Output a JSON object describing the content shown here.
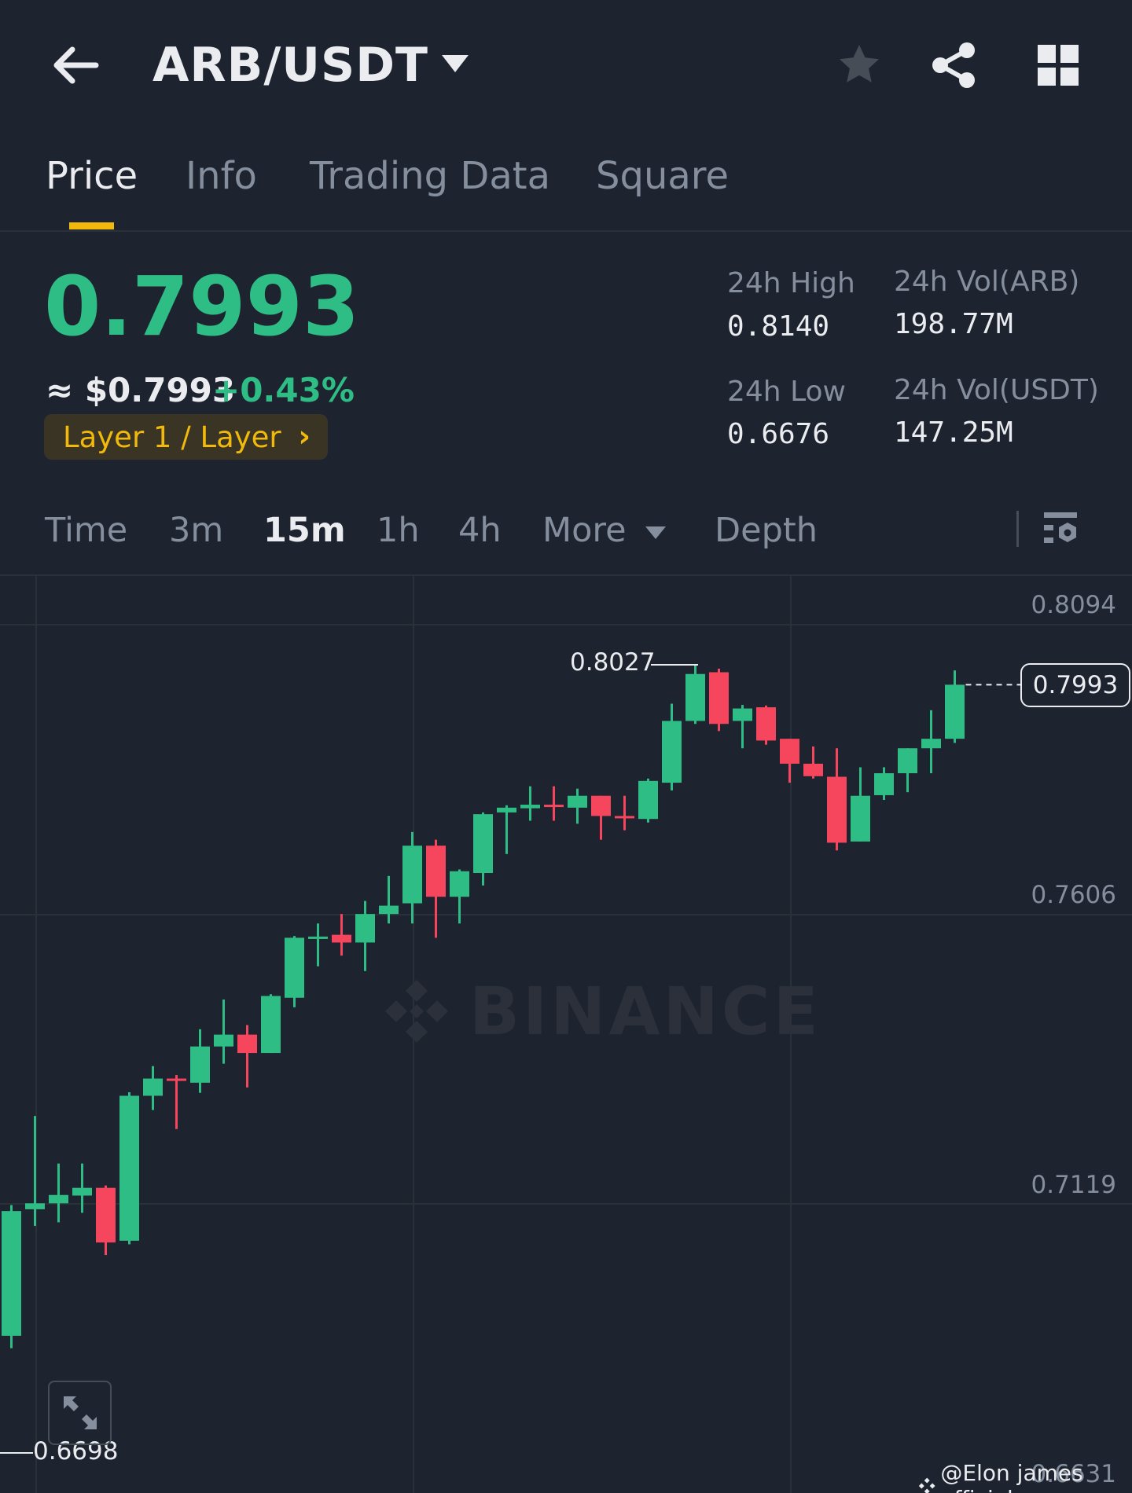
{
  "header": {
    "title": "ARB/USDT",
    "back_icon": "arrow-left-icon",
    "dropdown_icon": "caret-down-icon",
    "favorite_icon": "star-icon",
    "share_icon": "share-icon",
    "grid_icon": "grid-icon"
  },
  "tabs": [
    {
      "label": "Price",
      "active": true
    },
    {
      "label": "Info"
    },
    {
      "label": "Trading Data"
    },
    {
      "label": "Square"
    }
  ],
  "ticker": {
    "price": "0.7993",
    "fiat_price": "≈ $0.7993",
    "change_pct": "+0.43%",
    "category_tag": "Layer 1 / Layer",
    "high_label": "24h High",
    "high_value": "0.8140",
    "low_label": "24h Low",
    "low_value": "0.6676",
    "vol_base_label": "24h Vol(ARB)",
    "vol_base_value": "198.77M",
    "vol_quote_label": "24h Vol(USDT)",
    "vol_quote_value": "147.25M"
  },
  "intervals": [
    {
      "label": "Time"
    },
    {
      "label": "3m"
    },
    {
      "label": "15m",
      "active": true
    },
    {
      "label": "1h"
    },
    {
      "label": "4h"
    },
    {
      "label": "More"
    },
    {
      "label": "Depth"
    }
  ],
  "colors": {
    "up": "#2ebd85",
    "down": "#f6465d",
    "accent": "#f0b90b",
    "background": "#1e2330"
  },
  "watermark": "BINANCE",
  "credit": "@Elon james official",
  "chart_data": {
    "type": "candlestick",
    "interval": "15m",
    "y_ticks": [
      "0.8094",
      "0.7606",
      "0.7119",
      "0.6631"
    ],
    "ylim": [
      0.6631,
      0.8094
    ],
    "current_price": "0.7993",
    "visible_high_label": "0.8027",
    "visible_low_label": "0.6698",
    "candles": [
      [
        0.6897,
        0.7117,
        0.6876,
        0.7107
      ],
      [
        0.711,
        0.7267,
        0.7082,
        0.712
      ],
      [
        0.712,
        0.7187,
        0.7088,
        0.7134
      ],
      [
        0.7133,
        0.7187,
        0.7104,
        0.7146
      ],
      [
        0.7146,
        0.715,
        0.7033,
        0.7054
      ],
      [
        0.7057,
        0.7307,
        0.7051,
        0.7301
      ],
      [
        0.7301,
        0.7351,
        0.7277,
        0.733
      ],
      [
        0.733,
        0.7336,
        0.7245,
        0.7327
      ],
      [
        0.7323,
        0.7413,
        0.7306,
        0.7384
      ],
      [
        0.7384,
        0.7463,
        0.7355,
        0.7404
      ],
      [
        0.7404,
        0.742,
        0.7315,
        0.7373
      ],
      [
        0.7373,
        0.7472,
        0.7373,
        0.7469
      ],
      [
        0.7466,
        0.757,
        0.745,
        0.7567
      ],
      [
        0.7565,
        0.7591,
        0.7519,
        0.7569
      ],
      [
        0.7572,
        0.7607,
        0.7537,
        0.7559
      ],
      [
        0.7559,
        0.7629,
        0.7511,
        0.7607
      ],
      [
        0.7607,
        0.7671,
        0.7591,
        0.7621
      ],
      [
        0.7625,
        0.7745,
        0.7591,
        0.7722
      ],
      [
        0.7722,
        0.7732,
        0.7567,
        0.7636
      ],
      [
        0.7636,
        0.7682,
        0.7591,
        0.7679
      ],
      [
        0.7676,
        0.7778,
        0.7655,
        0.7775
      ],
      [
        0.7778,
        0.779,
        0.7708,
        0.7786
      ],
      [
        0.7785,
        0.7822,
        0.7764,
        0.7791
      ],
      [
        0.7791,
        0.7822,
        0.7764,
        0.7788
      ],
      [
        0.7786,
        0.7818,
        0.7759,
        0.7806
      ],
      [
        0.7806,
        0.7806,
        0.7732,
        0.7772
      ],
      [
        0.7772,
        0.7806,
        0.7748,
        0.7769
      ],
      [
        0.7767,
        0.7835,
        0.7761,
        0.7831
      ],
      [
        0.7828,
        0.7961,
        0.7815,
        0.7932
      ],
      [
        0.7932,
        0.8027,
        0.7927,
        0.8011
      ],
      [
        0.8014,
        0.802,
        0.7915,
        0.7927
      ],
      [
        0.7932,
        0.7959,
        0.7886,
        0.7953
      ],
      [
        0.7955,
        0.7958,
        0.7892,
        0.7899
      ],
      [
        0.7902,
        0.7902,
        0.7828,
        0.786
      ],
      [
        0.786,
        0.7889,
        0.7835,
        0.7839
      ],
      [
        0.7838,
        0.7886,
        0.7714,
        0.7727
      ],
      [
        0.7729,
        0.7854,
        0.7729,
        0.7806
      ],
      [
        0.7807,
        0.7854,
        0.7799,
        0.7844
      ],
      [
        0.7844,
        0.7886,
        0.7812,
        0.7886
      ],
      [
        0.7886,
        0.795,
        0.7844,
        0.7902
      ],
      [
        0.7902,
        0.8017,
        0.7895,
        0.7993
      ]
    ]
  }
}
